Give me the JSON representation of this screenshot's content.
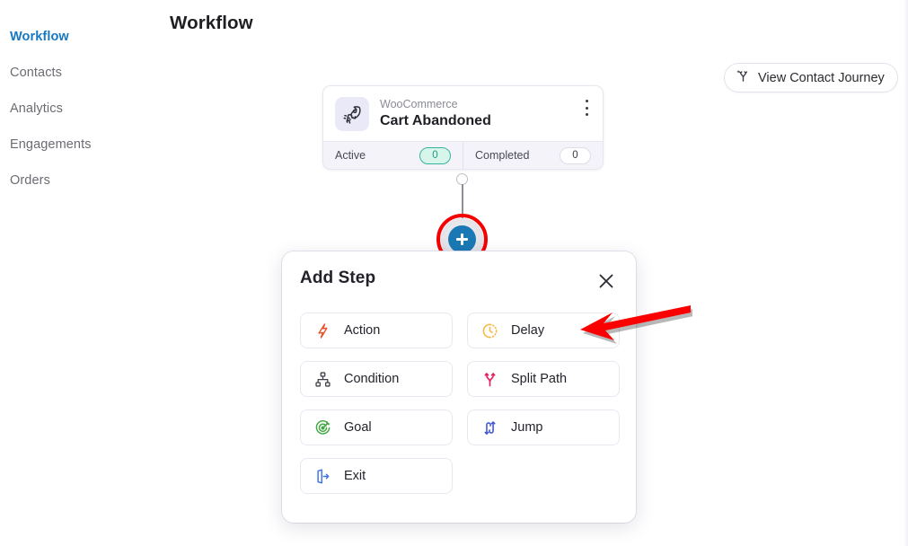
{
  "sidebar": {
    "items": [
      {
        "label": "Workflow",
        "active": true
      },
      {
        "label": "Contacts",
        "active": false
      },
      {
        "label": "Analytics",
        "active": false
      },
      {
        "label": "Engagements",
        "active": false
      },
      {
        "label": "Orders",
        "active": false
      }
    ]
  },
  "header": {
    "title": "Workflow",
    "journey_button": "View Contact Journey"
  },
  "trigger": {
    "app": "WooCommerce",
    "name": "Cart Abandoned",
    "icon": "rocket-icon",
    "stats": [
      {
        "label": "Active",
        "value": "0",
        "style": "green"
      },
      {
        "label": "Completed",
        "value": "0",
        "style": "white"
      }
    ]
  },
  "canvas": {
    "add_button_glyph": "+"
  },
  "modal": {
    "title": "Add Step",
    "close_label": "×",
    "options": [
      {
        "label": "Action",
        "icon": "lightning-bolt-icon",
        "color": "#e8512d"
      },
      {
        "label": "Delay",
        "icon": "clock-icon",
        "color": "#f5b73f"
      },
      {
        "label": "Condition",
        "icon": "hierarchy-icon",
        "color": "#3d3d46"
      },
      {
        "label": "Split Path",
        "icon": "split-path-icon",
        "color": "#e81f5d"
      },
      {
        "label": "Goal",
        "icon": "target-icon",
        "color": "#3fa63f"
      },
      {
        "label": "Jump",
        "icon": "jump-icon",
        "color": "#4257d6"
      },
      {
        "label": "Exit",
        "icon": "exit-door-icon",
        "color": "#3c72e6"
      }
    ]
  },
  "annotation": {
    "highlight_color": "#f40000",
    "arrow_color": "#fb0000",
    "points_to": "Delay"
  }
}
